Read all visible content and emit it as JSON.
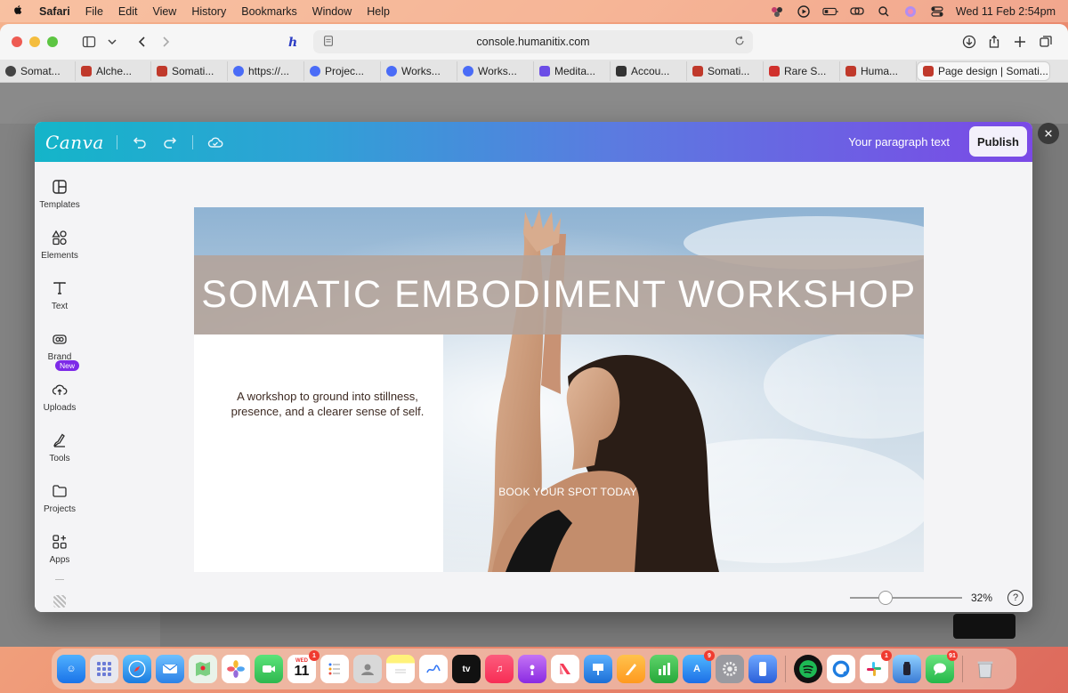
{
  "menubar": {
    "app": "Safari",
    "items": [
      "File",
      "Edit",
      "View",
      "History",
      "Bookmarks",
      "Window",
      "Help"
    ],
    "clock": "Wed 11 Feb  2:54pm"
  },
  "browser": {
    "url": "console.humanitix.com",
    "tabs": [
      {
        "label": "Somat...",
        "color": "#444444"
      },
      {
        "label": "Alche...",
        "color": "#c0392b"
      },
      {
        "label": "Somati...",
        "color": "#c0392b"
      },
      {
        "label": "https://...",
        "color": "#4a6cf7"
      },
      {
        "label": "Projec...",
        "color": "#4a6cf7"
      },
      {
        "label": "Works...",
        "color": "#4a6cf7"
      },
      {
        "label": "Works...",
        "color": "#4a6cf7"
      },
      {
        "label": "Medita...",
        "color": "#6b4de6"
      },
      {
        "label": "Accou...",
        "color": "#333333"
      },
      {
        "label": "Somati...",
        "color": "#c0392b"
      },
      {
        "label": "Rare S...",
        "color": "#d0312d"
      },
      {
        "label": "Huma...",
        "color": "#c0392b"
      },
      {
        "label": "Page design | Somati...",
        "color": "#c0392b"
      }
    ]
  },
  "canva": {
    "logo": "Canva",
    "paragraph_text": "Your paragraph text",
    "publish_label": "Publish",
    "sidebar": [
      {
        "label": "Templates",
        "icon": "templates-icon"
      },
      {
        "label": "Elements",
        "icon": "elements-icon"
      },
      {
        "label": "Text",
        "icon": "text-icon"
      },
      {
        "label": "Brand",
        "icon": "brand-icon"
      },
      {
        "label": "Uploads",
        "icon": "uploads-icon"
      },
      {
        "label": "Tools",
        "icon": "tools-icon"
      },
      {
        "label": "Projects",
        "icon": "projects-icon"
      },
      {
        "label": "Apps",
        "icon": "apps-icon"
      }
    ],
    "new_badge": "New",
    "zoom": "32%",
    "zoom_level": 0.32,
    "help": "?"
  },
  "design": {
    "title": "SOMATIC EMBODIMENT WORKSHOP",
    "description": "A workshop to ground into stillness, presence, and a clearer sense of self.",
    "cta": "BOOK YOUR SPOT TODAY"
  },
  "dock": {
    "calendar_day": "11",
    "badges": {
      "calendar": "1",
      "appstore": "9",
      "slack": "1",
      "messages": "91"
    }
  }
}
